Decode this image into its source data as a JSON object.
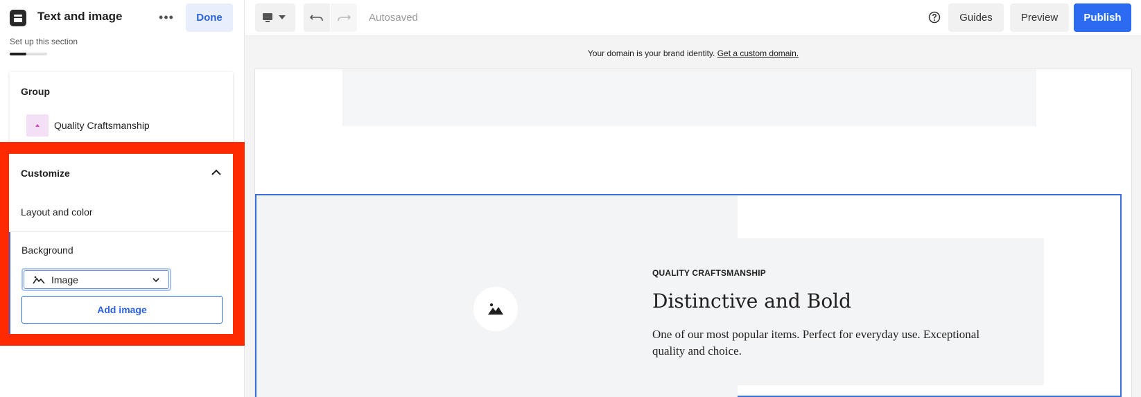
{
  "sidebar": {
    "title": "Text and image",
    "more_label": "•••",
    "done_label": "Done",
    "setup_label": "Set up this section",
    "setup_progress": 0.45,
    "group": {
      "title": "Group",
      "item_label": "Quality Craftsmanship"
    },
    "customize": {
      "title": "Customize",
      "layout_label": "Layout and color",
      "background_label": "Background",
      "background_select_value": "Image",
      "add_image_label": "Add image"
    }
  },
  "toolbar": {
    "autosaved_label": "Autosaved",
    "guides_label": "Guides",
    "preview_label": "Preview",
    "publish_label": "Publish"
  },
  "banner": {
    "text": "Your domain is your brand identity.",
    "link": "Get a custom domain."
  },
  "section": {
    "eyebrow": "QUALITY CRAFTSMANSHIP",
    "headline": "Distinctive and Bold",
    "body": "One of our most popular items. Perfect for everyday use. Exceptional quality and choice."
  },
  "icons": {
    "app": "app-icon",
    "more": "more-icon",
    "chevron_up": "chevron-up-icon",
    "image_select": "image-icon",
    "chevron_down": "chevron-down-icon",
    "device": "desktop-icon",
    "undo": "undo-icon",
    "redo": "redo-icon",
    "help": "help-icon",
    "placeholder": "image-placeholder-icon"
  },
  "colors": {
    "accent": "#2b6bf2",
    "highlight": "#ff2a00",
    "selection_border": "#3a6fd8"
  }
}
